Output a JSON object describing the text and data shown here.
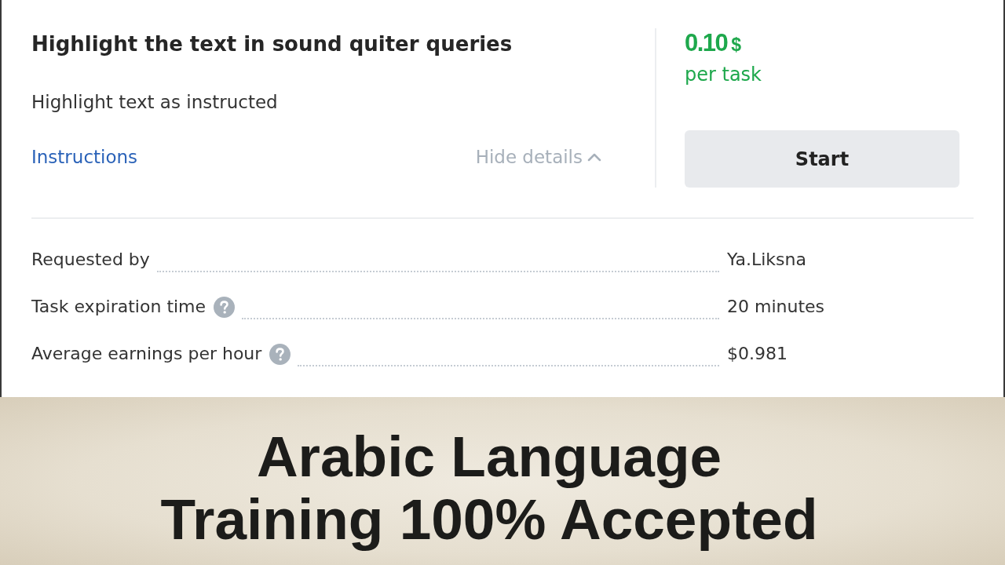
{
  "task": {
    "title": "Highlight the text in sound quiter queries",
    "description": "Highlight text as instructed",
    "instructions_link": "Instructions",
    "details_toggle": {
      "label": "Hide details",
      "expanded": true
    }
  },
  "price": {
    "amount": "0.10",
    "currency": "$",
    "unit": "per task"
  },
  "start_button": "Start",
  "details": [
    {
      "label": "Requested by",
      "help": false,
      "value": "Ya.Liksna"
    },
    {
      "label": "Task expiration time",
      "help": true,
      "value": "20 minutes"
    },
    {
      "label": "Average earnings per hour",
      "help": true,
      "value": "$0.981"
    }
  ],
  "banner": {
    "lines": [
      "Arabic Language",
      "Training 100% Accepted"
    ]
  }
}
